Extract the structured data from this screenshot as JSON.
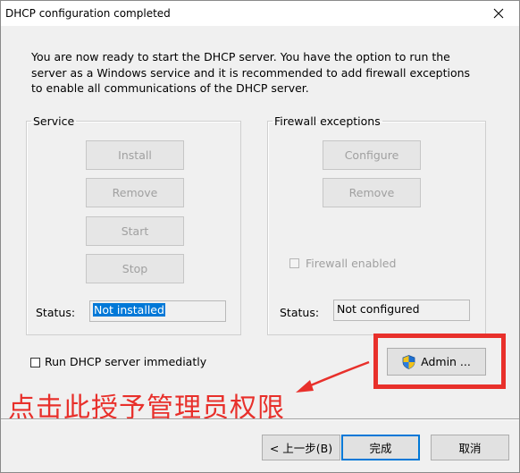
{
  "window": {
    "title": "DHCP configuration completed"
  },
  "intro": "You are now ready to start the DHCP server. You have the option to run the server as a Windows service and it is recommended to add firewall exceptions to enable all communications of the DHCP server.",
  "service": {
    "legend": "Service",
    "install_label": "Install",
    "remove_label": "Remove",
    "start_label": "Start",
    "stop_label": "Stop",
    "status_label": "Status:",
    "status_value": "Not installed"
  },
  "firewall": {
    "legend": "Firewall exceptions",
    "configure_label": "Configure",
    "remove_label": "Remove",
    "enabled_label": "Firewall enabled",
    "status_label": "Status:",
    "status_value": "Not configured"
  },
  "run_immediately_label": "Run DHCP server immediatly",
  "admin_label": "Admin ...",
  "annotation": "点击此授予管理员权限",
  "annotation_color": "#e8302b",
  "nav": {
    "back_label": "< 上一步(B)",
    "finish_label": "完成",
    "cancel_label": "取消"
  },
  "icons": {
    "close": "close-icon",
    "shield": "uac-shield-icon"
  }
}
